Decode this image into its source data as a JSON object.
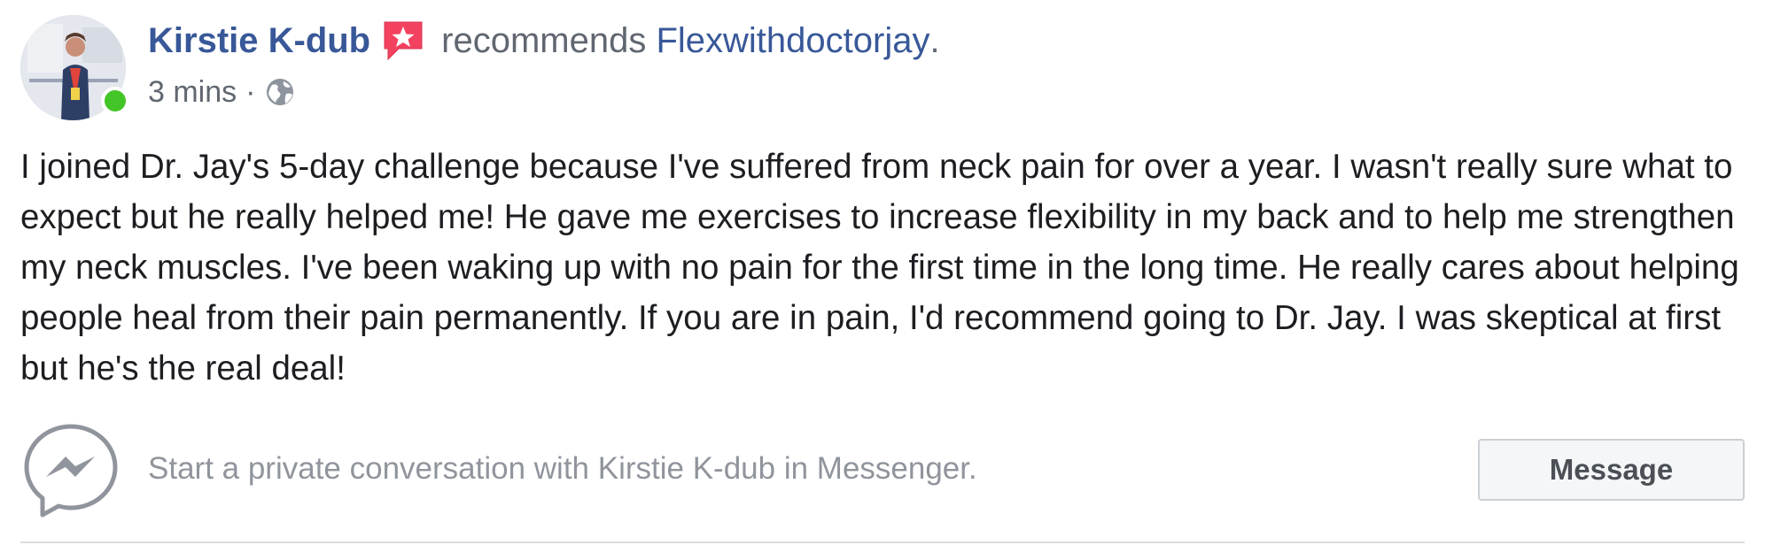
{
  "post": {
    "author": "Kirstie K-dub",
    "action_text": "recommends",
    "page_name": "Flexwithdoctorjay",
    "period": ".",
    "time": "3 mins",
    "separator": "·",
    "privacy_icon": "globe-icon",
    "recommend_badge_icon": "recommend-star-icon",
    "online_status": "online",
    "body": "I joined Dr. Jay's 5-day challenge because I've suffered from neck pain for over a year. I wasn't really sure what to expect but he really helped me! He gave me exercises to increase flexibility in my back and to help me strengthen my neck muscles. I've been waking up with no pain for the first time in the long time. He really cares about helping people heal from their pain permanently. If you are in pain, I'd recommend going to Dr. Jay. I was skeptical at first but he's the real deal!"
  },
  "messenger": {
    "icon": "messenger-icon",
    "prompt": "Start a private conversation with Kirstie K-dub in Messenger.",
    "button_label": "Message"
  },
  "colors": {
    "link_blue": "#385898",
    "secondary_text": "#606770",
    "body_text": "#1c1e21",
    "badge_red": "#f3425f",
    "online_green": "#44c527",
    "muted_text": "#90949c"
  }
}
